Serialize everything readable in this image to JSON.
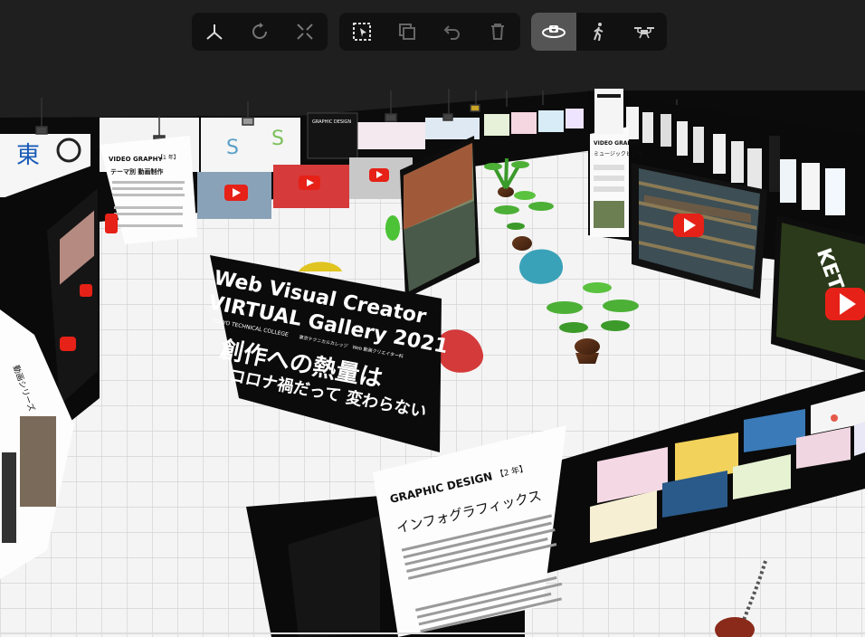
{
  "toolbar": {
    "groups": [
      {
        "buttons": [
          {
            "name": "axes-icon",
            "label": ""
          },
          {
            "name": "rotate-icon",
            "label": ""
          },
          {
            "name": "fullscreen-icon",
            "label": ""
          }
        ]
      },
      {
        "buttons": [
          {
            "name": "select-icon",
            "label": ""
          },
          {
            "name": "duplicate-icon",
            "label": ""
          },
          {
            "name": "undo-icon",
            "label": ""
          },
          {
            "name": "trash-icon",
            "label": ""
          }
        ]
      },
      {
        "buttons": [
          {
            "name": "orbit-camera-icon",
            "label": "",
            "active": true
          },
          {
            "name": "walk-icon",
            "label": ""
          },
          {
            "name": "drone-icon",
            "label": ""
          }
        ]
      }
    ]
  },
  "sign": {
    "line1": "Web Visual Creator",
    "line2": "VIRTUAL Gallery 2021",
    "subtitle_en": "TOKYO TECHNICAL COLLEGE",
    "subtitle_jp": "東京テクニカルカレッジ　Web 動画クリエイター科",
    "jp_line1": "創作への熱量は",
    "jp_line2": "コロナ禍だって 変わらない"
  },
  "graphic_design": {
    "title": "GRAPHIC DESIGN",
    "year": "【2 年】",
    "subtitle": "インフォグラフィックス"
  },
  "video_graphy": {
    "title": "VIDEO GRAPHY",
    "year": "【1 年】",
    "subtitle": "テーマ別 動画制作"
  },
  "graphic_design_far": {
    "title": "GRAPHIC DESIGN"
  },
  "wall_side_text": {
    "line1": "VIDEO GRAPHY",
    "line2": "ミュージックビデオ"
  },
  "left_panel": {
    "label": "動画シリーズ"
  },
  "big_screen": {
    "text": "KET IT"
  },
  "colors": {
    "accent_red": "#e62117",
    "floor": "#f2f2f2",
    "wall": "#0c0c0c"
  }
}
